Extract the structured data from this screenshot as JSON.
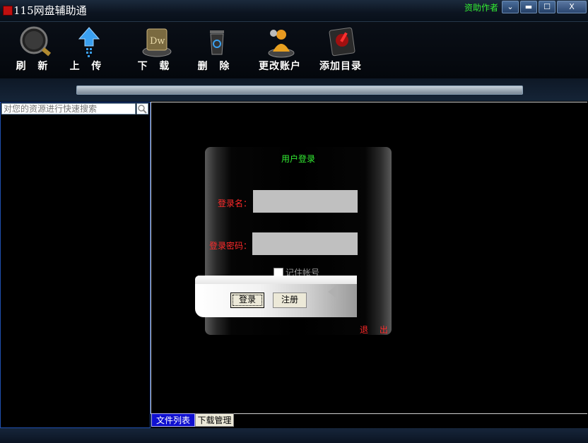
{
  "window": {
    "title": "115网盘辅助通",
    "donate_label": "资助作者",
    "min_label": "▬",
    "max_label": "☐",
    "close_label": "X"
  },
  "toolbar": {
    "refresh_label": "刷 新",
    "upload_label": "上 传",
    "download_label": "下 载",
    "delete_label": "删 除",
    "account_label": "更改账户",
    "add_dir_label": "添加目录"
  },
  "search": {
    "placeholder": "对您的资源进行快速搜索"
  },
  "login": {
    "title": "用户登录",
    "username_label": "登录名：",
    "password_label": "登录密码：",
    "remember_label": "记住帐号",
    "login_button": "登录",
    "register_button": "注册",
    "exit_button": "退 出"
  },
  "tabs": {
    "files": "文件列表",
    "downloads": "下载管理"
  },
  "colors": {
    "title_accent": "#33ee33",
    "label_red": "#ff2a2a",
    "tab_active": "#1010d0"
  }
}
